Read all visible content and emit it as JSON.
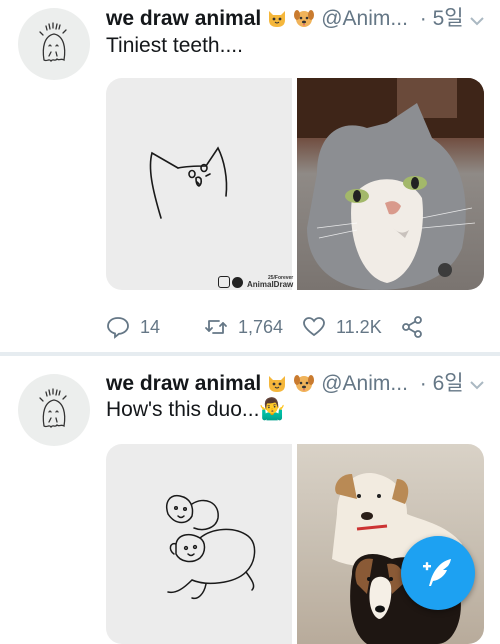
{
  "tweets": [
    {
      "author_name": "we draw animal",
      "handle": "@Anim...",
      "time": "· 5일",
      "text": "Tiniest teeth....",
      "watermark": {
        "line1": "25/Forever",
        "line2": "AnimalDraw"
      },
      "replies": "14",
      "retweets": "1,764",
      "likes": "11.2K"
    },
    {
      "author_name": "we draw animal",
      "handle": "@Anim...",
      "time": "· 6일",
      "text": "How's this duo...🤷‍♂️"
    }
  ],
  "icons": {
    "emoji_1": "cat-face-icon",
    "emoji_2": "dog-face-icon",
    "chevron": "chevron-down-icon",
    "reply": "reply-icon",
    "retweet": "retweet-icon",
    "like": "heart-icon",
    "share": "share-icon",
    "compose": "compose-tweet-icon"
  },
  "colors": {
    "accent": "#1da1f2",
    "secondary_text": "#657786",
    "separator": "#e6ecf0"
  }
}
